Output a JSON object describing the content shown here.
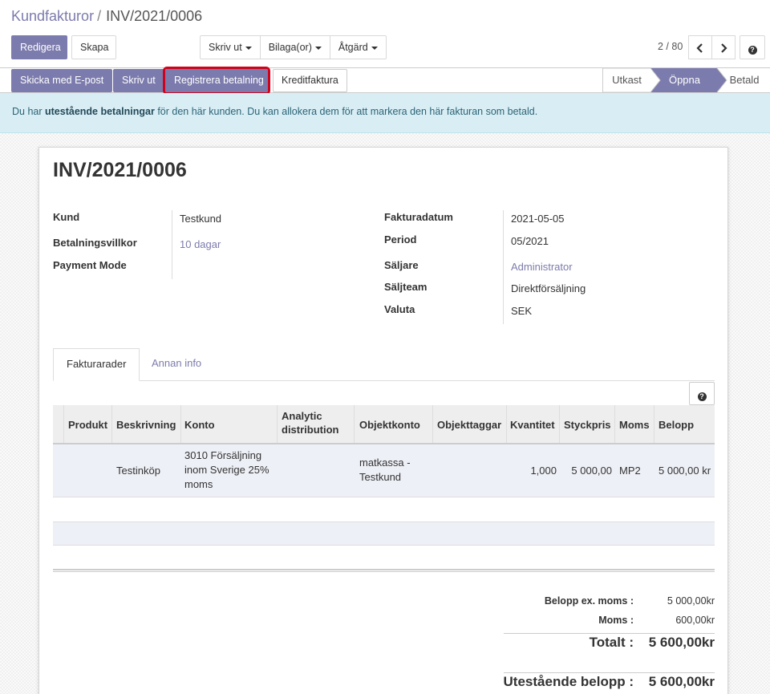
{
  "breadcrumb": {
    "parent": "Kundfakturor",
    "separator": "/",
    "current": "INV/2021/0006"
  },
  "toolbar": {
    "edit_label": "Redigera",
    "create_label": "Skapa",
    "print_label": "Skriv ut",
    "attachments_label": "Bilaga(or)",
    "action_label": "Åtgärd"
  },
  "pager": {
    "value": "2 / 80",
    "prev_icon": "chevron-left-icon",
    "next_icon": "chevron-right-icon"
  },
  "header_buttons": {
    "send_email": "Skicka med E-post",
    "print": "Skriv ut",
    "register_payment": "Registrera betalning",
    "credit_note": "Kreditfaktura"
  },
  "statusbar": {
    "stages": [
      "Utkast",
      "Öppna",
      "Betald"
    ],
    "active": "Öppna",
    "active_color": "#7c7bad"
  },
  "alert": {
    "prefix": "Du har ",
    "bold": "utestående betalningar",
    "suffix": " för den här kunden. Du kan allokera dem för att markera den här fakturan som betald."
  },
  "invoice": {
    "title": "INV/2021/0006",
    "left_fields": [
      {
        "label": "Kund",
        "value": "Testkund"
      },
      {
        "label": "Betalningsvillkor",
        "value": "10 dagar"
      },
      {
        "label": "Payment Mode",
        "value": ""
      }
    ],
    "right_fields": [
      {
        "label": "Fakturadatum",
        "value": "2021-05-05"
      },
      {
        "label": "Period",
        "value": "05/2021"
      },
      {
        "label": "Säljare",
        "value": "Administrator"
      },
      {
        "label": "Säljteam",
        "value": "Direktförsäljning"
      },
      {
        "label": "Valuta",
        "value": "SEK"
      }
    ]
  },
  "tabs": [
    "Fakturarader",
    "Annan info"
  ],
  "table": {
    "columns": [
      "Produkt",
      "Beskrivning",
      "Konto",
      "Analytic distribution",
      "Objektkonto",
      "Objekttaggar",
      "Kvantitet",
      "Styckpris",
      "Moms",
      "Belopp"
    ],
    "rows": [
      {
        "produkt": "",
        "beskrivning": "Testinköp",
        "konto": "3010 Försäljning inom Sverige 25% moms",
        "analytic": "",
        "objektkonto": "matkassa - Testkund",
        "objekttaggar": "",
        "kvantitet": "1,000",
        "styckpris": "5 000,00",
        "moms": "MP2",
        "belopp": "5 000,00 kr"
      }
    ]
  },
  "totals": {
    "excl_label": "Belopp ex. moms :",
    "excl_value": "5 000,00kr",
    "tax_label": "Moms :",
    "tax_value": "600,00kr",
    "total_label": "Totalt :",
    "total_value": "5 600,00kr",
    "due_label": "Utestående belopp :",
    "due_value": "5 600,00kr"
  },
  "colors": {
    "brand": "#7c7bad",
    "alert_bg": "#d9eef4",
    "highlight": "#d0021b"
  }
}
